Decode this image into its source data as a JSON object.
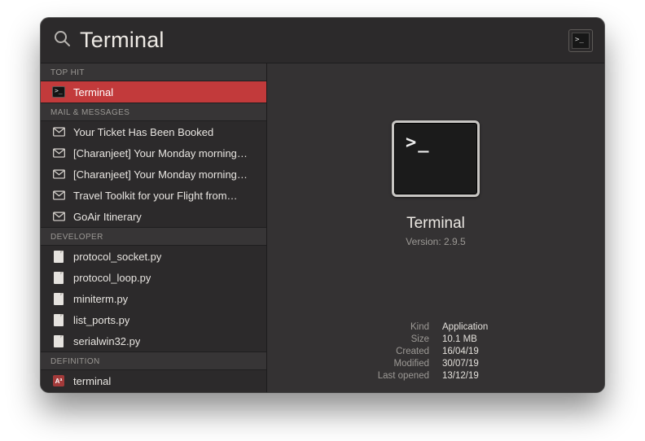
{
  "search": {
    "query": "Terminal"
  },
  "sections": {
    "top_hit": {
      "header": "TOP HIT",
      "items": [
        {
          "label": "Terminal"
        }
      ]
    },
    "mail": {
      "header": "MAIL & MESSAGES",
      "items": [
        {
          "label": "Your Ticket Has Been Booked"
        },
        {
          "label": "[Charanjeet] Your Monday morning…"
        },
        {
          "label": "[Charanjeet] Your Monday morning…"
        },
        {
          "label": "Travel Toolkit for your Flight from…"
        },
        {
          "label": "GoAir Itinerary"
        }
      ]
    },
    "developer": {
      "header": "DEVELOPER",
      "items": [
        {
          "label": "protocol_socket.py"
        },
        {
          "label": "protocol_loop.py"
        },
        {
          "label": "miniterm.py"
        },
        {
          "label": "list_ports.py"
        },
        {
          "label": "serialwin32.py"
        }
      ]
    },
    "definition": {
      "header": "DEFINITION",
      "items": [
        {
          "label": "terminal"
        }
      ]
    }
  },
  "preview": {
    "name": "Terminal",
    "version": "Version: 2.9.5",
    "meta": {
      "kind_k": "Kind",
      "kind_v": "Application",
      "size_k": "Size",
      "size_v": "10.1 MB",
      "created_k": "Created",
      "created_v": "16/04/19",
      "modified_k": "Modified",
      "modified_v": "30/07/19",
      "opened_k": "Last opened",
      "opened_v": "13/12/19"
    }
  },
  "icons": {
    "dict_glyph": "Aª"
  }
}
